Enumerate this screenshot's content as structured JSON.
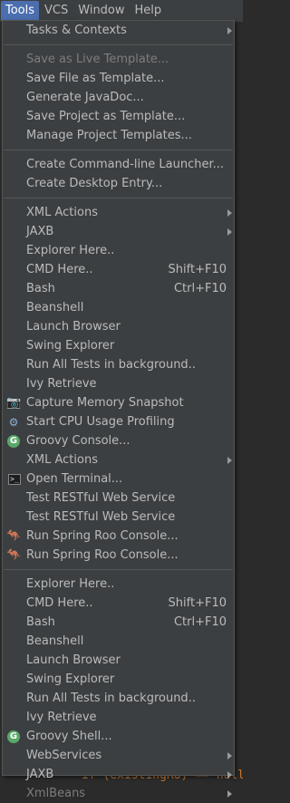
{
  "menubar": {
    "items": [
      {
        "label": "Tools",
        "active": true
      },
      {
        "label": "VCS",
        "active": false
      },
      {
        "label": "Window",
        "active": false
      },
      {
        "label": "Help",
        "active": false
      }
    ]
  },
  "menu": {
    "groups": [
      [
        {
          "label": "Tasks & Contexts",
          "submenu": true,
          "disabled": false
        }
      ],
      [
        {
          "label": "Save as Live Template...",
          "disabled": true
        },
        {
          "label": "Save File as Template...",
          "disabled": false
        },
        {
          "label": "Generate JavaDoc...",
          "disabled": false
        },
        {
          "label": "Save Project as Template...",
          "disabled": false
        },
        {
          "label": "Manage Project Templates...",
          "disabled": false
        }
      ],
      [
        {
          "label": "Create Command-line Launcher...",
          "disabled": false
        },
        {
          "label": "Create Desktop Entry...",
          "disabled": false
        }
      ],
      [
        {
          "label": "XML Actions",
          "submenu": true
        },
        {
          "label": "JAXB",
          "submenu": true
        },
        {
          "label": "Explorer Here.."
        },
        {
          "label": "CMD Here..",
          "shortcut": "Shift+F10"
        },
        {
          "label": "Bash",
          "shortcut": "Ctrl+F10"
        },
        {
          "label": "Beanshell"
        },
        {
          "label": "Launch Browser"
        },
        {
          "label": "Swing Explorer"
        },
        {
          "label": "Run All Tests in background.."
        },
        {
          "label": "Ivy Retrieve"
        },
        {
          "label": "Capture Memory Snapshot",
          "icon": "camera-icon"
        },
        {
          "label": "Start CPU Usage Profiling",
          "icon": "cpu-profiler-icon"
        },
        {
          "label": "Groovy Console...",
          "icon": "groovy-icon"
        },
        {
          "label": "XML Actions",
          "submenu": true
        },
        {
          "label": "Open Terminal...",
          "icon": "terminal-icon"
        },
        {
          "label": "Test RESTful Web Service"
        },
        {
          "label": "Test RESTful Web Service"
        },
        {
          "label": "Run Spring Roo Console...",
          "icon": "spring-roo-icon"
        },
        {
          "label": "Run Spring Roo Console...",
          "icon": "spring-roo-icon"
        }
      ],
      [
        {
          "label": "Explorer Here.."
        },
        {
          "label": "CMD Here..",
          "shortcut": "Shift+F10"
        },
        {
          "label": "Bash",
          "shortcut": "Ctrl+F10"
        },
        {
          "label": "Beanshell"
        },
        {
          "label": "Launch Browser"
        },
        {
          "label": "Swing Explorer"
        },
        {
          "label": "Run All Tests in background.."
        },
        {
          "label": "Ivy Retrieve"
        },
        {
          "label": "Groovy Shell...",
          "icon": "groovy-icon"
        },
        {
          "label": "WebServices",
          "submenu": true
        },
        {
          "label": "JAXB",
          "submenu": true
        },
        {
          "label": "XmlBeans",
          "submenu": true,
          "disabled": true
        }
      ]
    ]
  },
  "editor": {
    "bottom_code": "if (existingRU) == null) {"
  },
  "icons": {
    "groovy-icon": "G",
    "camera-icon": "📷",
    "cpu-profiler-icon": "⚙",
    "terminal-icon": ">_",
    "spring-roo-icon": "🦘"
  },
  "colors": {
    "menu_bg": "#3c3f41",
    "active_bg": "#4b6eaf",
    "text": "#bbbbbb",
    "disabled_text": "#7d7d7d",
    "groovy_green": "#59a869"
  }
}
